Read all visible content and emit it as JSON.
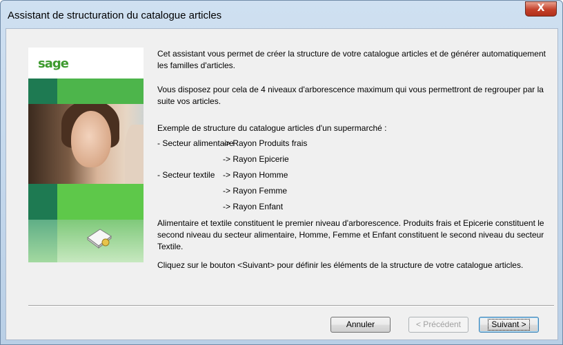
{
  "window": {
    "title": "Assistant de structuration du catalogue articles",
    "close_label": "X"
  },
  "side_panel": {
    "logo": "sage",
    "colors": {
      "dark_green": "#1e7a52",
      "teal": "#2f8f6a",
      "light_green": "#4db54b",
      "bright_green": "#5ec84a",
      "soft_green": "#a3d9a0"
    },
    "icon": "catalog-box-icon"
  },
  "content": {
    "p1": "Cet assistant vous permet de créer la structure de votre catalogue articles et de générer automatiquement les familles d'articles.",
    "p2": "Vous disposez pour cela de 4 niveaux d'arborescence maximum qui vous permettront de regrouper par la suite vos articles.",
    "p3": "Exemple de structure du catalogue articles d'un supermarché :",
    "example_rows": [
      {
        "left": "- Secteur alimentaire",
        "right": "-> Rayon Produits frais"
      },
      {
        "left": "",
        "right": "-> Rayon Epicerie"
      },
      {
        "left": "- Secteur textile",
        "right": "-> Rayon Homme"
      },
      {
        "left": "",
        "right": "-> Rayon Femme"
      },
      {
        "left": "",
        "right": "-> Rayon Enfant"
      }
    ],
    "p4": "Alimentaire et textile constituent le premier niveau d'arborescence. Produits frais et Epicerie constituent le second niveau du secteur alimentaire, Homme, Femme et Enfant constituent le second niveau du secteur Textile.",
    "p5": "Cliquez sur le bouton  <Suivant> pour définir les éléments de la structure de votre catalogue articles."
  },
  "buttons": {
    "cancel": "Annuler",
    "previous": "< Précédent",
    "next": "Suivant >"
  }
}
